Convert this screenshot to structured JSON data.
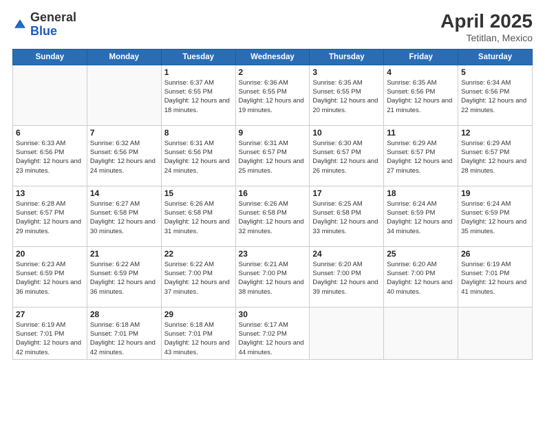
{
  "header": {
    "logo_general": "General",
    "logo_blue": "Blue",
    "title": "April 2025",
    "location": "Tetitlan, Mexico"
  },
  "weekdays": [
    "Sunday",
    "Monday",
    "Tuesday",
    "Wednesday",
    "Thursday",
    "Friday",
    "Saturday"
  ],
  "weeks": [
    [
      {
        "day": "",
        "info": ""
      },
      {
        "day": "",
        "info": ""
      },
      {
        "day": "1",
        "info": "Sunrise: 6:37 AM\nSunset: 6:55 PM\nDaylight: 12 hours and 18 minutes."
      },
      {
        "day": "2",
        "info": "Sunrise: 6:36 AM\nSunset: 6:55 PM\nDaylight: 12 hours and 19 minutes."
      },
      {
        "day": "3",
        "info": "Sunrise: 6:35 AM\nSunset: 6:55 PM\nDaylight: 12 hours and 20 minutes."
      },
      {
        "day": "4",
        "info": "Sunrise: 6:35 AM\nSunset: 6:56 PM\nDaylight: 12 hours and 21 minutes."
      },
      {
        "day": "5",
        "info": "Sunrise: 6:34 AM\nSunset: 6:56 PM\nDaylight: 12 hours and 22 minutes."
      }
    ],
    [
      {
        "day": "6",
        "info": "Sunrise: 6:33 AM\nSunset: 6:56 PM\nDaylight: 12 hours and 23 minutes."
      },
      {
        "day": "7",
        "info": "Sunrise: 6:32 AM\nSunset: 6:56 PM\nDaylight: 12 hours and 24 minutes."
      },
      {
        "day": "8",
        "info": "Sunrise: 6:31 AM\nSunset: 6:56 PM\nDaylight: 12 hours and 24 minutes."
      },
      {
        "day": "9",
        "info": "Sunrise: 6:31 AM\nSunset: 6:57 PM\nDaylight: 12 hours and 25 minutes."
      },
      {
        "day": "10",
        "info": "Sunrise: 6:30 AM\nSunset: 6:57 PM\nDaylight: 12 hours and 26 minutes."
      },
      {
        "day": "11",
        "info": "Sunrise: 6:29 AM\nSunset: 6:57 PM\nDaylight: 12 hours and 27 minutes."
      },
      {
        "day": "12",
        "info": "Sunrise: 6:29 AM\nSunset: 6:57 PM\nDaylight: 12 hours and 28 minutes."
      }
    ],
    [
      {
        "day": "13",
        "info": "Sunrise: 6:28 AM\nSunset: 6:57 PM\nDaylight: 12 hours and 29 minutes."
      },
      {
        "day": "14",
        "info": "Sunrise: 6:27 AM\nSunset: 6:58 PM\nDaylight: 12 hours and 30 minutes."
      },
      {
        "day": "15",
        "info": "Sunrise: 6:26 AM\nSunset: 6:58 PM\nDaylight: 12 hours and 31 minutes."
      },
      {
        "day": "16",
        "info": "Sunrise: 6:26 AM\nSunset: 6:58 PM\nDaylight: 12 hours and 32 minutes."
      },
      {
        "day": "17",
        "info": "Sunrise: 6:25 AM\nSunset: 6:58 PM\nDaylight: 12 hours and 33 minutes."
      },
      {
        "day": "18",
        "info": "Sunrise: 6:24 AM\nSunset: 6:59 PM\nDaylight: 12 hours and 34 minutes."
      },
      {
        "day": "19",
        "info": "Sunrise: 6:24 AM\nSunset: 6:59 PM\nDaylight: 12 hours and 35 minutes."
      }
    ],
    [
      {
        "day": "20",
        "info": "Sunrise: 6:23 AM\nSunset: 6:59 PM\nDaylight: 12 hours and 36 minutes."
      },
      {
        "day": "21",
        "info": "Sunrise: 6:22 AM\nSunset: 6:59 PM\nDaylight: 12 hours and 36 minutes."
      },
      {
        "day": "22",
        "info": "Sunrise: 6:22 AM\nSunset: 7:00 PM\nDaylight: 12 hours and 37 minutes."
      },
      {
        "day": "23",
        "info": "Sunrise: 6:21 AM\nSunset: 7:00 PM\nDaylight: 12 hours and 38 minutes."
      },
      {
        "day": "24",
        "info": "Sunrise: 6:20 AM\nSunset: 7:00 PM\nDaylight: 12 hours and 39 minutes."
      },
      {
        "day": "25",
        "info": "Sunrise: 6:20 AM\nSunset: 7:00 PM\nDaylight: 12 hours and 40 minutes."
      },
      {
        "day": "26",
        "info": "Sunrise: 6:19 AM\nSunset: 7:01 PM\nDaylight: 12 hours and 41 minutes."
      }
    ],
    [
      {
        "day": "27",
        "info": "Sunrise: 6:19 AM\nSunset: 7:01 PM\nDaylight: 12 hours and 42 minutes."
      },
      {
        "day": "28",
        "info": "Sunrise: 6:18 AM\nSunset: 7:01 PM\nDaylight: 12 hours and 42 minutes."
      },
      {
        "day": "29",
        "info": "Sunrise: 6:18 AM\nSunset: 7:01 PM\nDaylight: 12 hours and 43 minutes."
      },
      {
        "day": "30",
        "info": "Sunrise: 6:17 AM\nSunset: 7:02 PM\nDaylight: 12 hours and 44 minutes."
      },
      {
        "day": "",
        "info": ""
      },
      {
        "day": "",
        "info": ""
      },
      {
        "day": "",
        "info": ""
      }
    ]
  ]
}
